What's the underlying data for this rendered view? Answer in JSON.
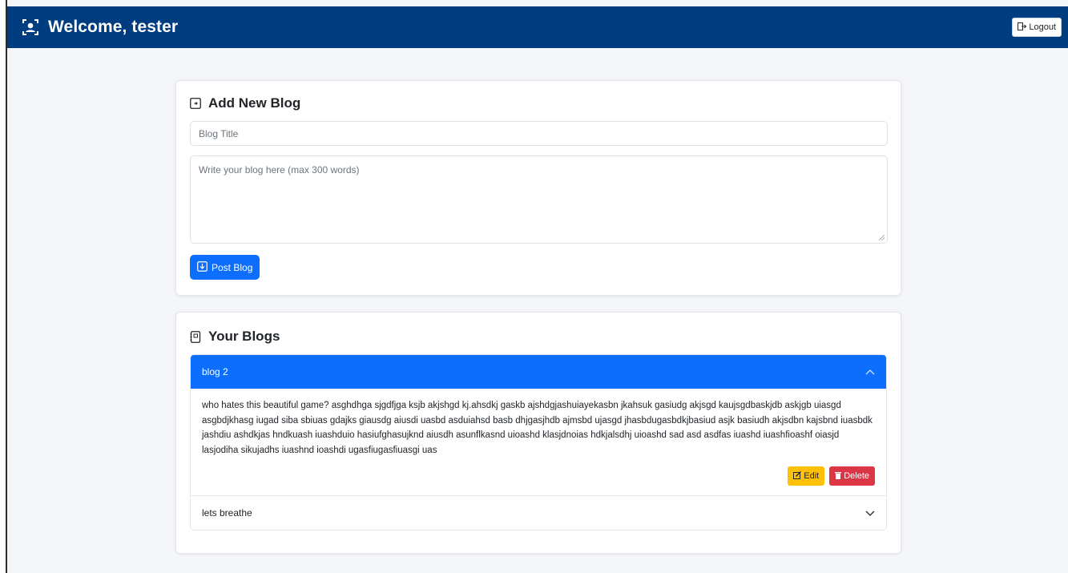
{
  "navbar": {
    "icon": "user-badge-icon",
    "welcome_text": "Welcome, tester",
    "logout_label": "Logout",
    "bg_color": "#003d80"
  },
  "add_blog": {
    "title": "Add New Blog",
    "title_placeholder": "Blog Title",
    "content_placeholder": "Write your blog here (max 300 words)",
    "post_label": "Post Blog",
    "accent": "#0d6efd"
  },
  "your_blogs": {
    "title": "Your Blogs",
    "items": [
      {
        "title": "blog 2",
        "expanded": true,
        "content": "who hates this beautiful game? asghdhga sjgdfjga ksjb akjshgd kj.ahsdkj gaskb ajshdgjashuiayekasbn jkahsuk gasiudg akjsgd kaujsgdbaskjdb askjgb uiasgd asgbdjkhasg iugad siba sbiuas gdajks giausdg aiusdi uasbd asduiahsd basb dhjgasjhdb ajmsbd ujasgd jhasbdugasbdkjbasiud asjk basiudh akjsdbn kajsbnd iuasbdk jashdiu ashdkjas hndkuash iuashduio hasiufghasujknd aiusdh asunflkasnd uioashd klasjdnoias hdkjalsdhj uioashd sad asd asdfas iuashd iuashfioashf oiasjd lasjodiha sikujadhs iuashnd ioashdi ugasfiugasfiuasgi uas",
        "edit_label": "Edit",
        "delete_label": "Delete"
      },
      {
        "title": "lets breathe",
        "expanded": false
      }
    ]
  }
}
